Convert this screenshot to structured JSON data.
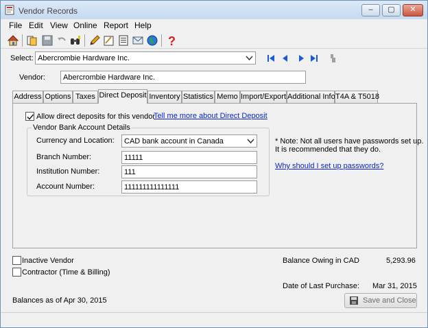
{
  "window": {
    "title": "Vendor Records",
    "controls": {
      "minimize": "–",
      "maximize": "▢",
      "close": "✕"
    }
  },
  "menu": [
    "File",
    "Edit",
    "View",
    "Online",
    "Report",
    "Help"
  ],
  "toolbar_icons": [
    "home-icon",
    "open-record-icon",
    "save-icon",
    "undo-icon",
    "binoculars-icon",
    "edit-icon",
    "notes-icon",
    "print-icon",
    "email-icon",
    "globe-icon",
    "help-icon"
  ],
  "select": {
    "label": "Select:",
    "value": "Abercrombie Hardware Inc."
  },
  "vendor": {
    "label": "Vendor:",
    "value": "Abercrombie Hardware Inc."
  },
  "tabs": [
    "Address",
    "Options",
    "Taxes",
    "Direct Deposit",
    "Inventory",
    "Statistics",
    "Memo",
    "Import/Export",
    "Additional Info",
    "T4A & T5018"
  ],
  "active_tab": "Direct Deposit",
  "direct_deposit": {
    "allow_label": "Allow direct deposits for this vendor",
    "allow_checked": true,
    "tell_me_link": "Tell me more about Direct Deposit",
    "group_title": "Vendor Bank Account Details",
    "currency_label": "Currency and Location:",
    "currency_value": "CAD bank account in Canada",
    "branch_label": "Branch Number:",
    "branch_value": "11111",
    "institution_label": "Institution Number:",
    "institution_value": "111",
    "account_label": "Account Number:",
    "account_value": "111111111111111",
    "note_line1": "* Note: Not all users have passwords set up.",
    "note_line2": "It is recommended that they do.",
    "password_link": "Why should I set up passwords?"
  },
  "footer": {
    "inactive_label": "Inactive Vendor",
    "contractor_label": "Contractor (Time & Billing)",
    "balance_label": "Balance Owing in CAD",
    "balance_value": "5,293.96",
    "last_purchase_label": "Date of Last Purchase:",
    "last_purchase_value": "Mar 31, 2015",
    "balances_as_of": "Balances as of Apr 30, 2015",
    "save_close_label": "Save and Close"
  }
}
